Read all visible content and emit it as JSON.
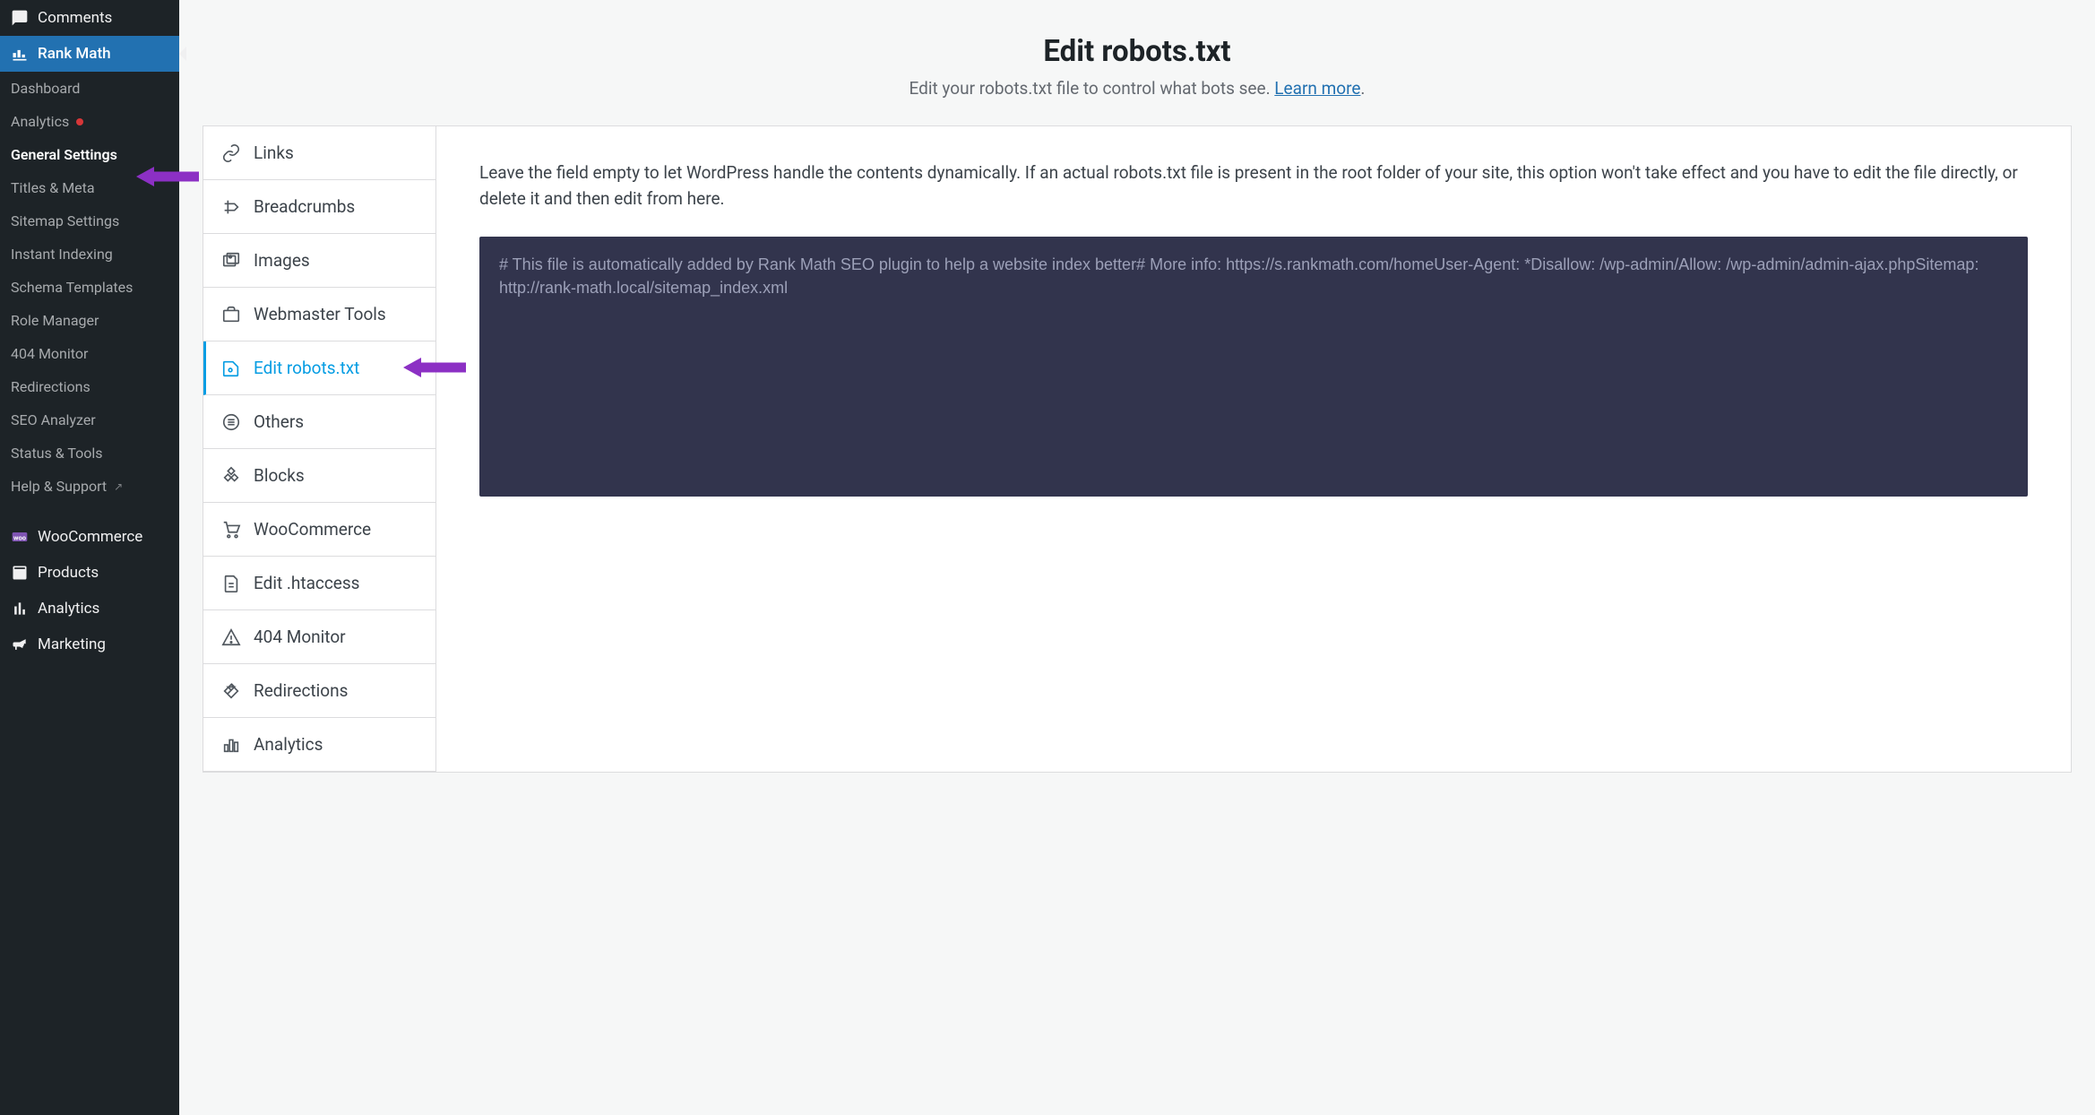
{
  "wp_menu": {
    "comments": "Comments",
    "rank_math": "Rank Math",
    "woocommerce": "WooCommerce",
    "products": "Products",
    "analytics": "Analytics",
    "marketing": "Marketing"
  },
  "rm_submenu": {
    "dashboard": "Dashboard",
    "analytics": "Analytics",
    "general_settings": "General Settings",
    "titles_meta": "Titles & Meta",
    "sitemap_settings": "Sitemap Settings",
    "instant_indexing": "Instant Indexing",
    "schema_templates": "Schema Templates",
    "role_manager": "Role Manager",
    "monitor_404": "404 Monitor",
    "redirections": "Redirections",
    "seo_analyzer": "SEO Analyzer",
    "status_tools": "Status & Tools",
    "help_support": "Help & Support"
  },
  "header": {
    "title": "Edit robots.txt",
    "subtitle_pre": "Edit your robots.txt file to control what bots see. ",
    "learn_more": "Learn more",
    "period": "."
  },
  "tabs": {
    "links": "Links",
    "breadcrumbs": "Breadcrumbs",
    "images": "Images",
    "webmaster_tools": "Webmaster Tools",
    "edit_robots": "Edit robots.txt",
    "others": "Others",
    "blocks": "Blocks",
    "woocommerce": "WooCommerce",
    "edit_htaccess": "Edit .htaccess",
    "monitor_404": "404 Monitor",
    "redirections": "Redirections",
    "analytics": "Analytics"
  },
  "panel": {
    "desc": "Leave the field empty to let WordPress handle the contents dynamically. If an actual robots.txt file is present in the root folder of your site, this option won't take effect and you have to edit the file directly, or delete it and then edit from here.",
    "editor": "# This file is automatically added by Rank Math SEO plugin to help a website index better# More info: https://s.rankmath.com/homeUser-Agent: *Disallow: /wp-admin/Allow: /wp-admin/admin-ajax.phpSitemap: http://rank-math.local/sitemap_index.xml"
  },
  "colors": {
    "arrow": "#8c30c4"
  }
}
